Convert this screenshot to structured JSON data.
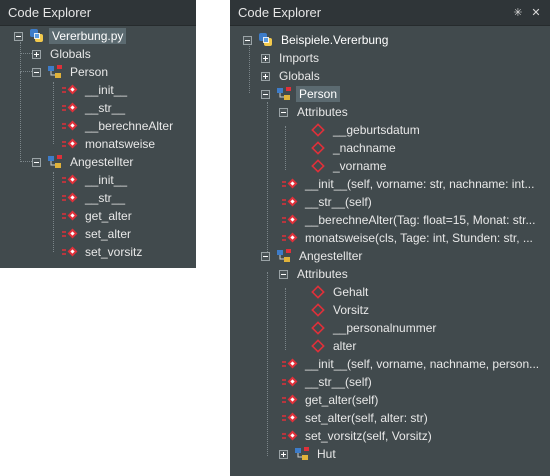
{
  "left": {
    "title": "Code Explorer",
    "module": "Vererbung.py",
    "globals": "Globals",
    "class1": "Person",
    "class1_methods": [
      "__init__",
      "__str__",
      "__berechneAlter",
      "monatsweise"
    ],
    "class2": "Angestellter",
    "class2_methods": [
      "__init__",
      "__str__",
      "get_alter",
      "set_alter",
      "set_vorsitz"
    ]
  },
  "right": {
    "title": "Code Explorer",
    "pin_label": "✳",
    "close_label": "✕",
    "module": "Beispiele.Vererbung",
    "imports": "Imports",
    "globals": "Globals",
    "class1": "Person",
    "attributes_label": "Attributes",
    "class1_attributes": [
      "__geburtsdatum",
      "_nachname",
      "_vorname"
    ],
    "class1_methods": [
      "__init__(self, vorname: str, nachname: int...",
      "__str__(self)",
      "__berechneAlter(Tag: float=15, Monat: str...",
      "monatsweise(cls, Tage: int, Stunden: str, ..."
    ],
    "class2": "Angestellter",
    "class2_attributes": [
      "Gehalt",
      "Vorsitz",
      "__personalnummer",
      "alter"
    ],
    "class2_methods": [
      "__init__(self, vorname, nachname, person...",
      "__str__(self)",
      "get_alter(self)",
      "set_alter(self, alter: str)",
      "set_vorsitz(self, Vorsitz)"
    ],
    "hut": "Hut"
  },
  "colors": {
    "panel_bg": "#414a4d",
    "title_bg": "#2f3538",
    "text": "#e8e8e8",
    "method_icon": "#e0303a",
    "selection": "#5b6a70"
  }
}
